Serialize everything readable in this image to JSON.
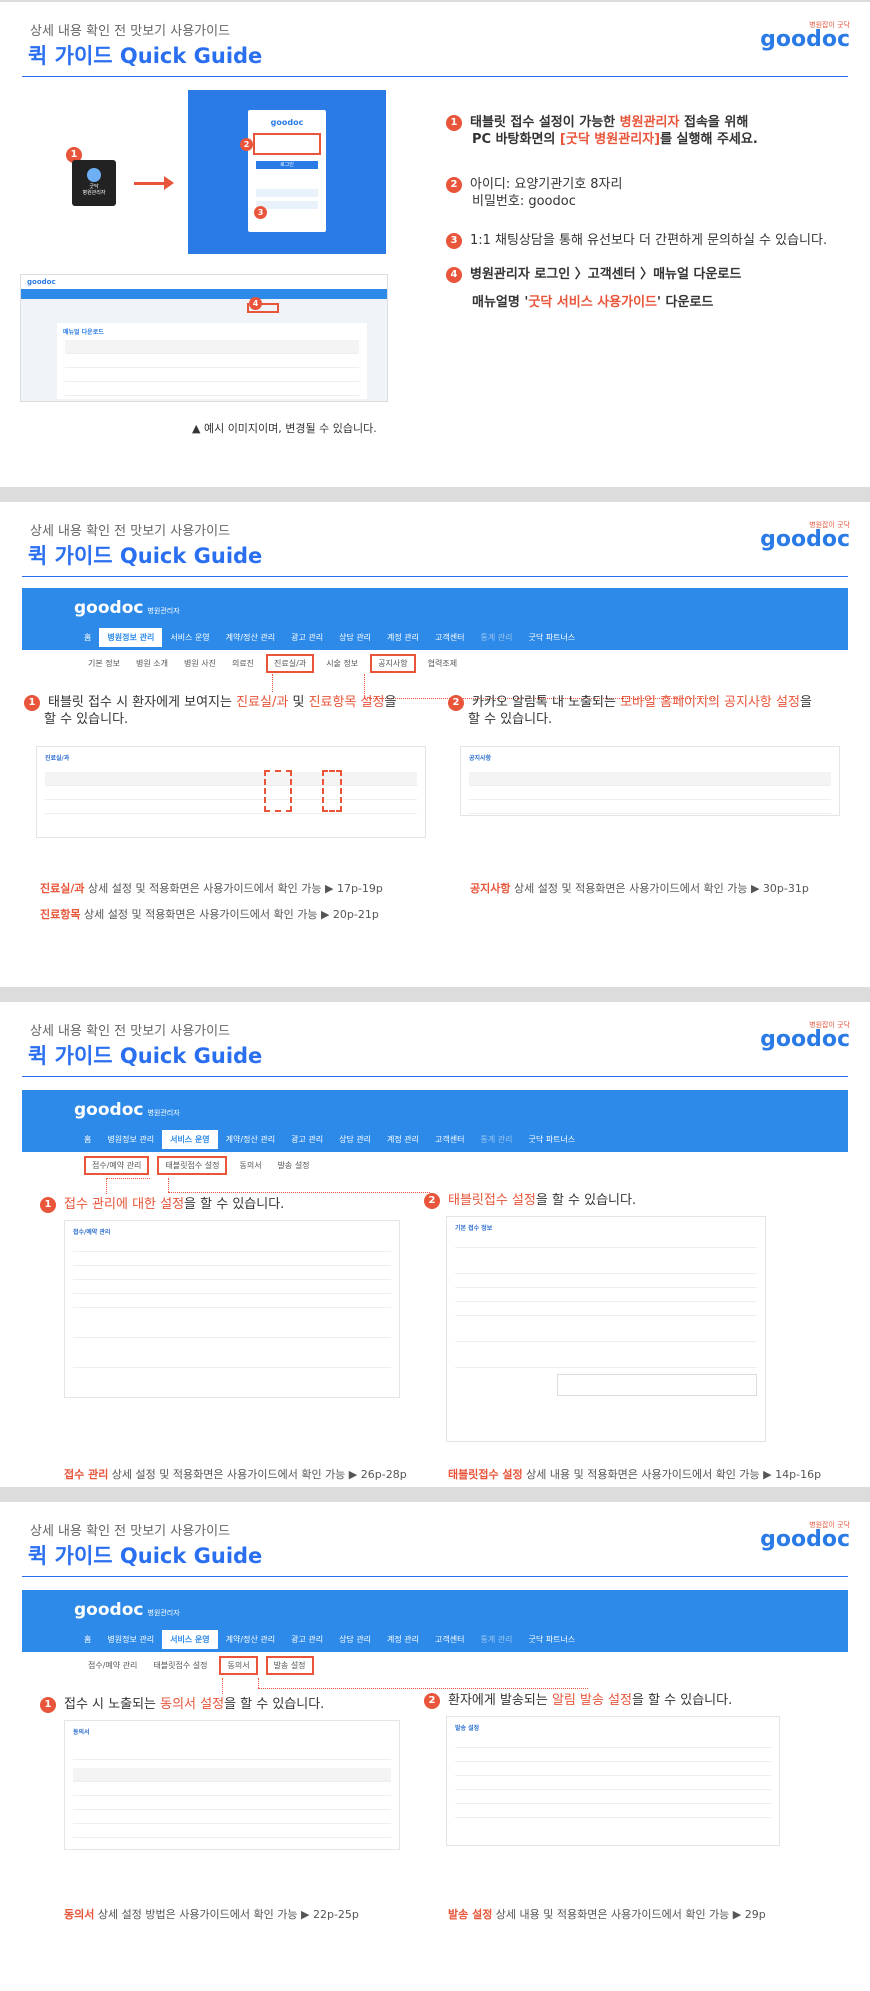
{
  "header": {
    "subtitle": "상세 내용 확인 전 맛보기 사용가이드",
    "title": "퀵 가이드 Quick Guide",
    "brand_tag": "병원잡이 굿닥",
    "brand_logo": "goodoc"
  },
  "nav": {
    "logo": "goodoc",
    "logo_sub": "병원관리자",
    "items": [
      "홈",
      "병원정보 관리",
      "서비스 운영",
      "계약/정산 관리",
      "광고 관리",
      "상담 관리",
      "계정 관리",
      "고객센터",
      "통계 관리",
      "굿닥 파트너스"
    ]
  },
  "page1": {
    "icon_caption": "굿닥\n병원관리자",
    "login_logo": "goodoc",
    "login_btn": "로그인",
    "manual_title": "매뉴얼 다운로드",
    "steps": [
      {
        "num": "1",
        "a": "태블릿 접수 설정이 가능한 ",
        "b": "병원관리자",
        "c": " 접속을 위해",
        "d": "PC 바탕화면의 ",
        "e": "[굿닥 병원관리자]",
        "f": "를 실행해 주세요."
      },
      {
        "num": "2",
        "line1": "아이디: 요양기관기호 8자리",
        "line2": "비밀번호: goodoc"
      },
      {
        "num": "3",
        "text": "1:1 채팅상담을 통해 유선보다 더 간편하게 문의하실 수 있습니다."
      },
      {
        "num": "4",
        "line1": "병원관리자 로그인 〉고객센터 〉매뉴얼 다운로드",
        "line2a": "매뉴얼명 '",
        "line2b": "굿닥 서비스 사용가이드",
        "line2c": "' 다운로드"
      }
    ],
    "caption": "▲ 예시 이미지이며, 변경될 수 있습니다."
  },
  "page2": {
    "subtabs": [
      "기본 정보",
      "병원 소개",
      "병원 사진",
      "의료진",
      "진료실/과",
      "시술 정보",
      "공지사항",
      "협력조제"
    ],
    "left_a": "태블릿 접수 시 환자에게 보여지는 ",
    "left_b": "진료실/과",
    "left_c": " 및 ",
    "left_d": "진료항목 설정",
    "left_e": "을",
    "left_f": "할 수 있습니다.",
    "right_a": "카카오 알림톡 내 노출되는 ",
    "right_b": "모바일 홈페이지의 공지사항 설정",
    "right_c": "을",
    "right_d": "할 수 있습니다.",
    "foot1_red": "진료실/과",
    "foot1": " 상세 설정 및 적용화면은 사용가이드에서 확인 가능 ▶ 17p-19p",
    "foot2_red": "진료항목",
    "foot2": "  상세 설정 및 적용화면은 사용가이드에서 확인 가능 ▶ 20p-21p",
    "foot3_red": "공지사항",
    "foot3": " 상세 설정 및 적용화면은 사용가이드에서 확인 가능 ▶ 30p-31p",
    "shot_left_title": "진료실/과",
    "shot_right_title": "공지사항"
  },
  "page3": {
    "subtabs": [
      "접수/예약 관리",
      "태블릿접수 설정",
      "동의서",
      "발송 설정"
    ],
    "left_a": "접수 관리에 대한 설정",
    "left_b": "을 할 수 있습니다.",
    "right_a": "태블릿접수 설정",
    "right_b": "을 할 수 있습니다.",
    "foot1_red": "접수 관리",
    "foot1": " 상세 설정 및 적용화면은 사용가이드에서 확인 가능 ▶ 26p-28p",
    "foot2_red": "태블릿접수 설정",
    "foot2": " 상세 내용 및 적용화면은 사용가이드에서 확인 가능 ▶ 14p-16p",
    "shot_left_title": "접수/예약 관리",
    "shot_right_title": "기본 접수 정보"
  },
  "page4": {
    "subtabs": [
      "접수/예약 관리",
      "태블릿접수 설정",
      "동의서",
      "발송 설정"
    ],
    "left_a": "접수 시 노출되는 ",
    "left_b": "동의서 설정",
    "left_c": "을 할 수 있습니다.",
    "right_a": "환자에게 발송되는 ",
    "right_b": "알림 발송 설정",
    "right_c": "을 할 수 있습니다.",
    "foot1_red": "동의서",
    "foot1": " 상세 설정 방법은 사용가이드에서 확인 가능 ▶ 22p-25p",
    "foot2_red": "발송 설정",
    "foot2": " 상세 내용 및 적용화면은 사용가이드에서 확인 가능 ▶ 29p",
    "shot_left_title": "동의서",
    "shot_right_title": "발송 설정"
  }
}
